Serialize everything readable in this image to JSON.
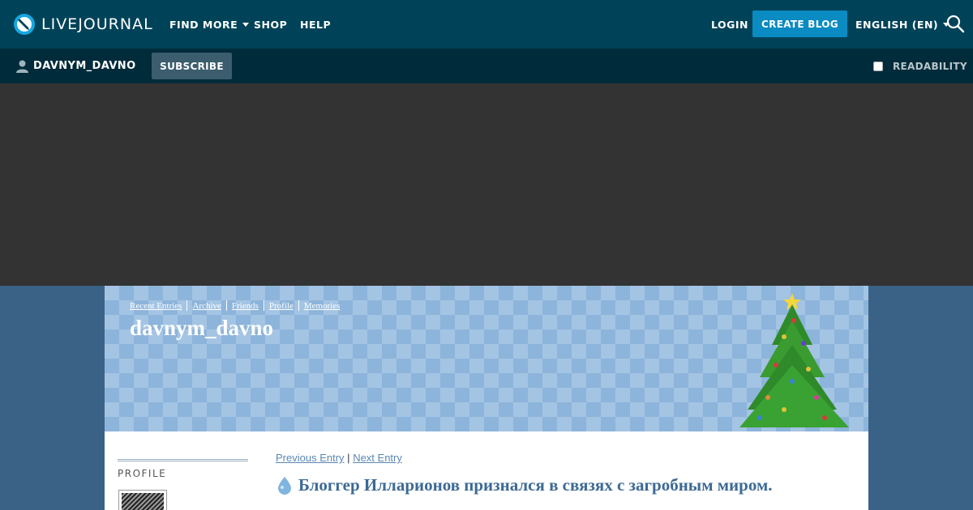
{
  "app": {
    "logo_text": "LIVEJOURNAL",
    "nav": {
      "find_more": "FIND MORE",
      "shop": "SHOP",
      "help": "HELP",
      "login": "LOGIN",
      "create_blog": "CREATE BLOG",
      "language": "ENGLISH (EN)"
    },
    "subbar": {
      "username": "DAVNYM_DAVNO",
      "subscribe": "SUBSCRIBE",
      "readability": "READABILITY"
    }
  },
  "journal": {
    "links": [
      "Recent Entries",
      "Archive",
      "Friends",
      "Profile",
      "Memories"
    ],
    "title": "davnym_davno",
    "sidebar": {
      "profile_label": "PROFILE"
    },
    "entry": {
      "prev": "Previous Entry",
      "separator": "|",
      "next": "Next Entry",
      "title": "Блоггер Илларионов признался в связях с загробным миром."
    }
  },
  "colors": {
    "topbar": "#004359",
    "subbar": "#002b3a",
    "accent": "#0a8bc2",
    "page_bg": "#3a6186",
    "header_pattern": "#a4c4e4"
  },
  "icons": [
    "livejournal-logo-icon",
    "caret-down-icon",
    "search-icon",
    "user-icon",
    "checkbox-icon",
    "christmas-tree-icon",
    "entry-bullet-icon"
  ]
}
